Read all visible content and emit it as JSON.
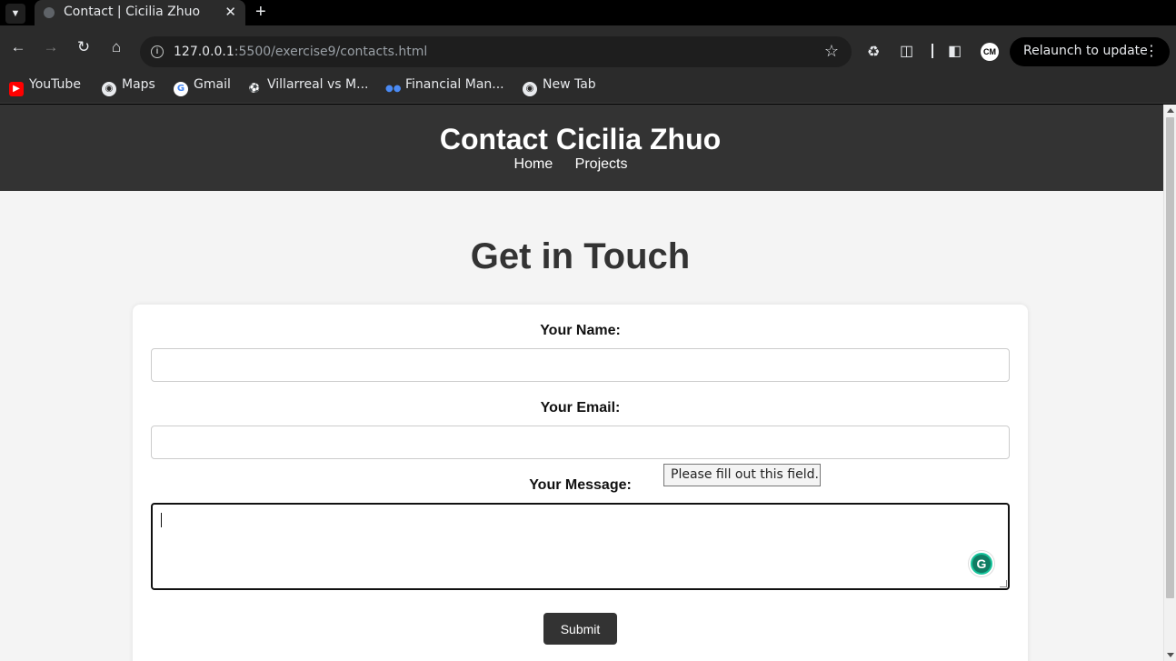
{
  "browser": {
    "tab": {
      "title": "Contact | Cicilia Zhuo"
    },
    "address": {
      "host": "127.0.0.1",
      "rest": ":5500/exercise9/contacts.html"
    },
    "relaunch_label": "Relaunch to update",
    "avatar_initials": "CM",
    "bookmarks": [
      {
        "label": "YouTube",
        "icon": "youtube-icon",
        "color": "#ff0000"
      },
      {
        "label": "Maps",
        "icon": "globe-icon",
        "color": "#e8eaed"
      },
      {
        "label": "Gmail",
        "icon": "google-icon",
        "color": "#4285f4"
      },
      {
        "label": "Villarreal vs M...",
        "icon": "soccer-icon",
        "color": "#e8eaed"
      },
      {
        "label": "Financial Man...",
        "icon": "people-icon",
        "color": "#4a8af4"
      },
      {
        "label": "New Tab",
        "icon": "globe-icon",
        "color": "#e8eaed"
      }
    ]
  },
  "site": {
    "title": "Contact Cicilia Zhuo",
    "nav": [
      "Home",
      "Projects"
    ]
  },
  "page": {
    "heading": "Get in Touch",
    "form": {
      "name_label": "Your Name:",
      "name_value": "",
      "email_label": "Your Email:",
      "email_value": "",
      "message_label": "Your Message:",
      "message_value": "",
      "submit_label": "Submit"
    },
    "validation_tooltip": "Please fill out this field."
  },
  "colors": {
    "header_bg": "#333333",
    "page_bg": "#f4f4f4",
    "button_bg": "#333333",
    "grammarly": "#15c39a"
  }
}
